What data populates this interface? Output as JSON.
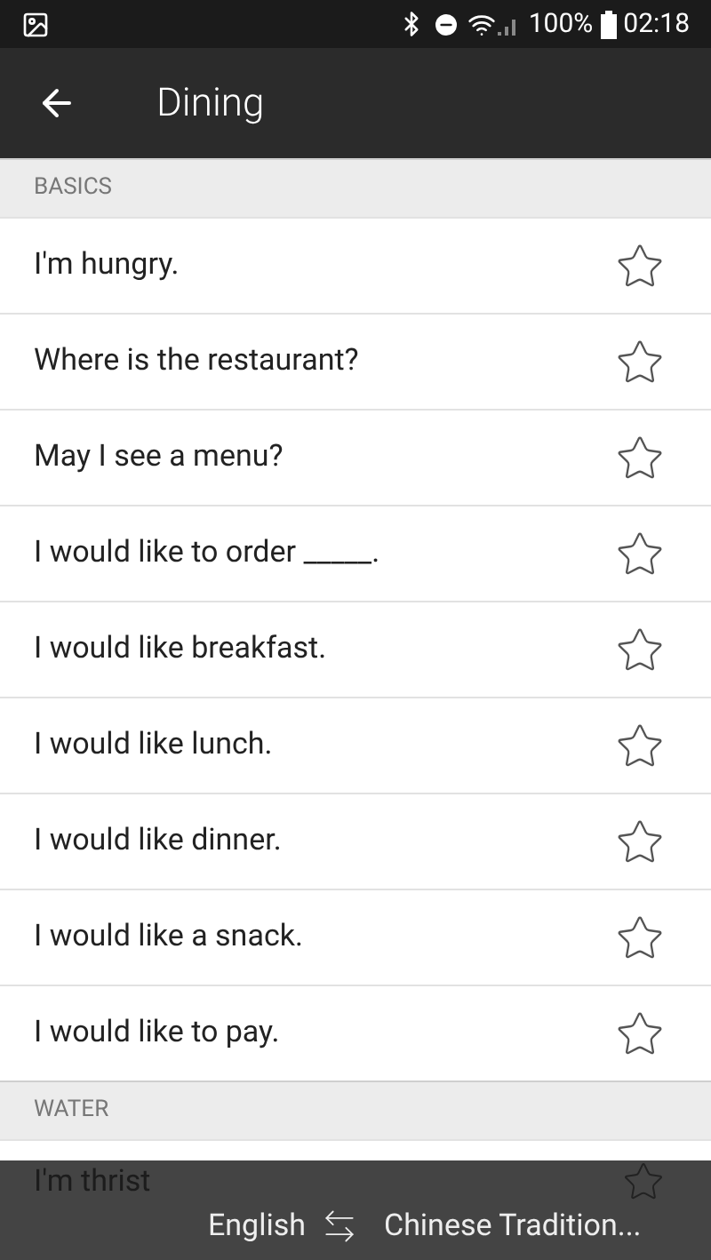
{
  "status_bar": {
    "battery": "100%",
    "time": "02:18"
  },
  "app_bar": {
    "title": "Dining"
  },
  "sections": [
    {
      "title": "BASICS",
      "phrases": [
        {
          "text": "I'm hungry.",
          "favorite": false
        },
        {
          "text": "Where is the restaurant?",
          "favorite": false
        },
        {
          "text": "May I see a menu?",
          "favorite": false
        },
        {
          "text": "I would like to order _____.",
          "favorite": false
        },
        {
          "text": "I would like breakfast.",
          "favorite": false
        },
        {
          "text": "I would like lunch.",
          "favorite": false
        },
        {
          "text": "I would like dinner.",
          "favorite": false
        },
        {
          "text": "I would like a snack.",
          "favorite": false
        },
        {
          "text": "I would like to pay.",
          "favorite": false
        }
      ]
    },
    {
      "title": "WATER",
      "phrases": [
        {
          "text": "I'm thrist",
          "favorite": false
        }
      ]
    }
  ],
  "language_bar": {
    "source": "English",
    "target": "Chinese Tradition..."
  }
}
